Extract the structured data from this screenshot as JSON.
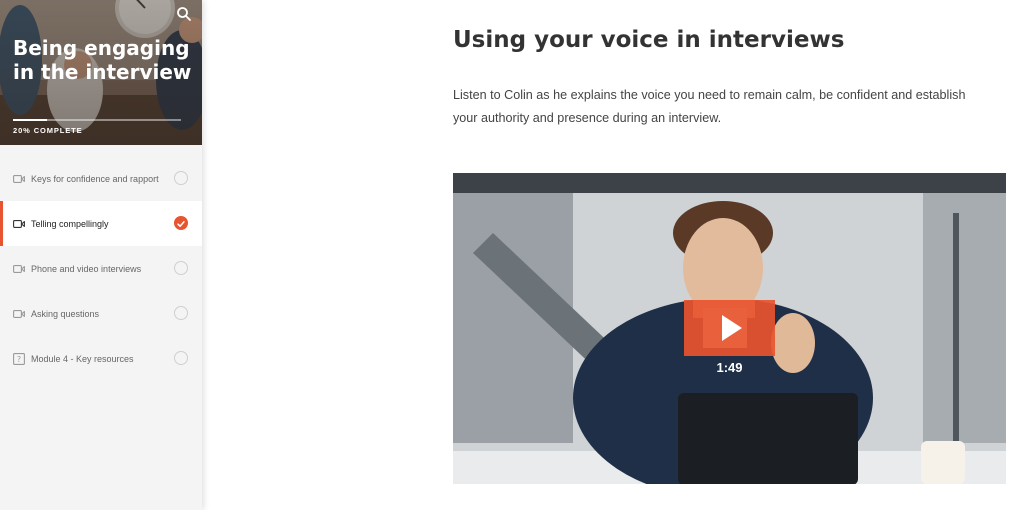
{
  "course": {
    "title": "Being engaging in the interview",
    "progress_label": "20% COMPLETE",
    "progress_fraction": 0.2
  },
  "sidebar": {
    "items": [
      {
        "label": "Keys for confidence and rapport",
        "icon": "video-icon",
        "status": "incomplete",
        "active": false
      },
      {
        "label": "Telling compellingly",
        "icon": "video-icon",
        "status": "complete",
        "active": true
      },
      {
        "label": "Phone and video interviews",
        "icon": "video-icon",
        "status": "incomplete",
        "active": false
      },
      {
        "label": "Asking questions",
        "icon": "video-icon",
        "status": "incomplete",
        "active": false
      },
      {
        "label": "Module 4 - Key resources",
        "icon": "question-icon",
        "status": "incomplete",
        "active": false
      }
    ]
  },
  "main": {
    "title": "Using your voice in interviews",
    "description": "Listen to Colin as he explains the voice you need to remain calm, be confident and establish your authority and presence during an interview.",
    "video": {
      "duration": "1:49",
      "accent": "#e8542f"
    }
  },
  "colors": {
    "accent": "#e8542f",
    "sidebar_bg": "#f4f4f4"
  }
}
